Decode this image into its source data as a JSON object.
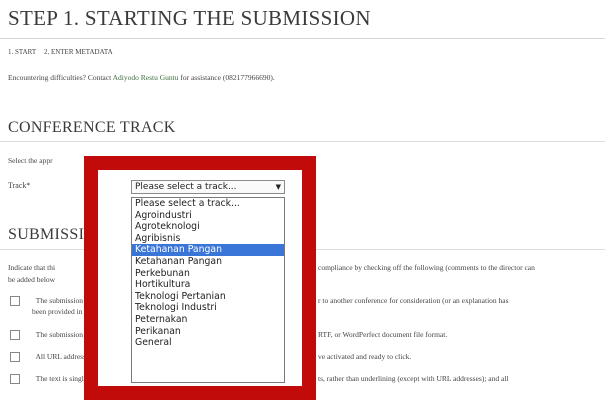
{
  "page": {
    "title": "STEP 1. STARTING THE SUBMISSION",
    "steps": [
      "1. START",
      "2. ENTER METADATA"
    ],
    "help_prefix": "Encountering difficulties? Contact",
    "help_contact": "Adiyodo Restu Guntu",
    "help_suffix": "for assistance (082177966690)."
  },
  "conference_track": {
    "heading": "CONFERENCE TRACK",
    "instruction": "Select the appr",
    "track_label": "Track*",
    "selected_value": "Please select a track...",
    "options": [
      "Please select a track...",
      "Agroindustri",
      "Agroteknologi",
      "Agribisnis",
      "Ketahanan Pangan",
      "Ketahanan Pangan",
      "Perkebunan",
      "Hortikultura",
      "Teknologi Pertanian",
      "Teknologi Industri",
      "Peternakan",
      "Perikanan",
      "General"
    ],
    "highlighted_index": 4
  },
  "submission": {
    "heading_visible": "SUBMISSION",
    "intro_left": "Indicate that thi",
    "intro_right": "compliance by checking off the following (comments to the director can",
    "intro_line2": "be added below",
    "checklist": [
      {
        "left": "The submission has",
        "right": "r to another conference for consideration (or an explanation has",
        "cont": "been provided in Co"
      },
      {
        "left": "The submission file",
        "right": "RTF, or WordPerfect document file format.",
        "cont": ""
      },
      {
        "left": "All URL addresses i",
        "right": "ve activated and ready to click.",
        "cont": ""
      },
      {
        "left": "The text is single-sp",
        "right": "ts, rather than underlining (except with URL addresses); and all",
        "cont": ""
      }
    ]
  },
  "colors": {
    "highlight_frame": "#c10a0a",
    "selected_option_bg": "#3a76d8",
    "link": "#3b6e3b"
  }
}
